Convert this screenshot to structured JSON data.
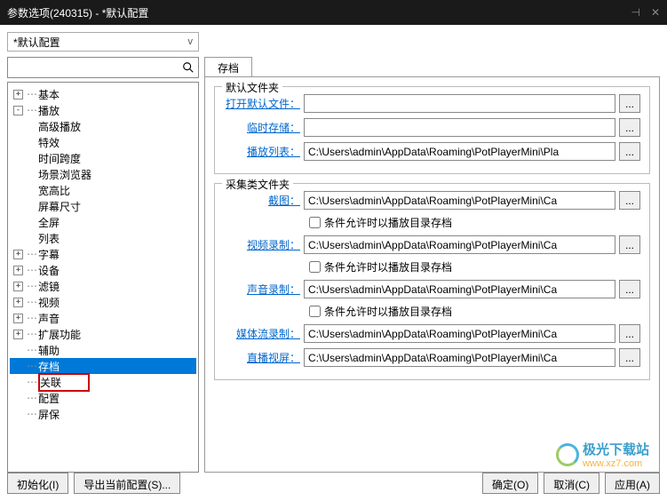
{
  "window": {
    "title": "参数选项(240315) - *默认配置",
    "config_dropdown": "*默认配置",
    "dropdown_arrow": "v"
  },
  "tree": {
    "items": [
      {
        "id": "basic",
        "label": "基本",
        "expand": "+",
        "level": 0
      },
      {
        "id": "playback",
        "label": "播放",
        "expand": "-",
        "level": 0
      },
      {
        "id": "adv-playback",
        "label": "高级播放",
        "level": 1
      },
      {
        "id": "effects",
        "label": "特效",
        "level": 1
      },
      {
        "id": "timespan",
        "label": "时间跨度",
        "level": 1
      },
      {
        "id": "scene-browser",
        "label": "场景浏览器",
        "level": 1
      },
      {
        "id": "aspect",
        "label": "宽高比",
        "level": 1
      },
      {
        "id": "screen-size",
        "label": "屏幕尺寸",
        "level": 1
      },
      {
        "id": "fullscreen",
        "label": "全屏",
        "level": 1
      },
      {
        "id": "list",
        "label": "列表",
        "level": 1
      },
      {
        "id": "subtitle",
        "label": "字幕",
        "expand": "+",
        "level": 0
      },
      {
        "id": "device",
        "label": "设备",
        "expand": "+",
        "level": 0
      },
      {
        "id": "filter",
        "label": "滤镜",
        "expand": "+",
        "level": 0
      },
      {
        "id": "video",
        "label": "视频",
        "expand": "+",
        "level": 0
      },
      {
        "id": "audio",
        "label": "声音",
        "expand": "+",
        "level": 0
      },
      {
        "id": "extension",
        "label": "扩展功能",
        "expand": "+",
        "level": 0
      },
      {
        "id": "assist",
        "label": "辅助",
        "level": 0,
        "noexpand": true
      },
      {
        "id": "archive",
        "label": "存档",
        "level": 0,
        "noexpand": true,
        "selected": true
      },
      {
        "id": "association",
        "label": "关联",
        "level": 0,
        "noexpand": true,
        "highlight": true
      },
      {
        "id": "config",
        "label": "配置",
        "level": 0,
        "noexpand": true
      },
      {
        "id": "screensaver",
        "label": "屏保",
        "level": 0,
        "noexpand": true
      }
    ]
  },
  "tab": {
    "name": "存档"
  },
  "group1": {
    "title": "默认文件夹",
    "open_default": {
      "label": "打开默认文件",
      "value": ""
    },
    "temp_storage": {
      "label": "临时存储",
      "value": ""
    },
    "playlist": {
      "label": "播放列表",
      "value": "C:\\Users\\admin\\AppData\\Roaming\\PotPlayerMini\\Pla"
    }
  },
  "group2": {
    "title": "采集类文件夹",
    "screenshot": {
      "label": "截图",
      "value": "C:\\Users\\admin\\AppData\\Roaming\\PotPlayerMini\\Ca"
    },
    "screenshot_cb": "条件允许时以播放目录存档",
    "video_rec": {
      "label": "视频录制",
      "value": "C:\\Users\\admin\\AppData\\Roaming\\PotPlayerMini\\Ca"
    },
    "video_cb": "条件允许时以播放目录存档",
    "audio_rec": {
      "label": "声音录制",
      "value": "C:\\Users\\admin\\AppData\\Roaming\\PotPlayerMini\\Ca"
    },
    "audio_cb": "条件允许时以播放目录存档",
    "stream_rec": {
      "label": "媒体流录制",
      "value": "C:\\Users\\admin\\AppData\\Roaming\\PotPlayerMini\\Ca"
    },
    "live_screen": {
      "label": "直播视屏",
      "value": "C:\\Users\\admin\\AppData\\Roaming\\PotPlayerMini\\Ca"
    }
  },
  "buttons": {
    "init": "初始化(I)",
    "export": "导出当前配置(S)...",
    "ok": "确定(O)",
    "cancel": "取消(C)",
    "apply": "应用(A)",
    "browse": "..."
  },
  "watermark": {
    "t1": "极光下载站",
    "t2": "www.xz7.com"
  }
}
